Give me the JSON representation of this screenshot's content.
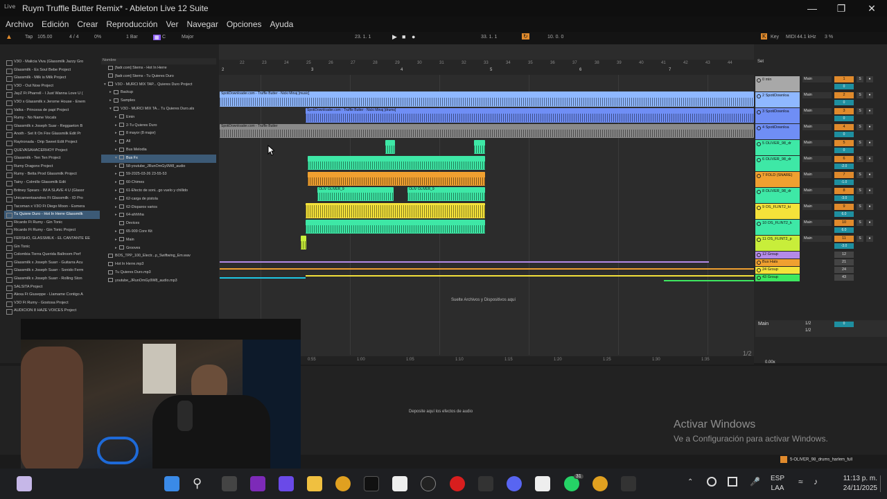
{
  "window": {
    "title": "Ruym Truffle Butter Remix* - Ableton Live 12 Suite",
    "logo": "Live"
  },
  "menu": [
    "Archivo",
    "Edición",
    "Crear",
    "Reproducción",
    "Ver",
    "Navegar",
    "Opciones",
    "Ayuda"
  ],
  "control_bar": {
    "tap": "Tap",
    "tempo": "105.00",
    "sig": "4 / 4",
    "pct": "0%",
    "bar": "1 Bar",
    "key": "C",
    "scale": "Major",
    "position": "23. 1. 1",
    "loop_start": "33. 1. 1",
    "loop_len": "10. 0. 0",
    "key_label": "Key",
    "midi": "MIDI",
    "sample_rate": "44.1 kHz",
    "cpu": "3 %"
  },
  "browser": {
    "column_header": "Nombre",
    "places": [
      "V3O - Malicia Viva (Glassmilk Jazzy Gro",
      "Glassmilk - Es Soul Bebe Project",
      "Glassmilk - Milk is Milk Project",
      "V3O - Out Now Project",
      "JayZ Ft Pharrell - I Just Wanna Love U (",
      "V3O x Glassmilk x Jerome House - Enem",
      "Valka - Princesa de papi Project",
      "Rumy - No Name Vocals",
      "Glassmilk x Joseph Suar - Reggaeton B",
      "Anoth - Set It On Fire Glassmilk Edit Pr",
      "Raytronada - Drip Sweet Edit Project",
      "QUEVASAHACERHOY Project",
      "Glassmilk - Ten Ten Project",
      "Rumy Dragonx Project",
      "Rumy - Betta Prod Glassmilk Project",
      "Tainy - Colmillo Glassmilk Edit",
      "Britney Spears - IM A SLAVE 4 U (Glassr",
      "Unicamentsandres Ft Glassmilk - ID Pro",
      "Tacoman x V3O Ft Diego Moon - Esmera",
      "Tu Quiere Duro - Hot In Herre Glassmilk",
      "Ricardo Ft Rumy - Gin Tonic",
      "Ricardo Ft Rumy - Gin Tonic Project",
      "FERSHO, GLASSMILK - EL CANTANTE EE",
      "Gin Tonic",
      "Colombia Tierra Querida Ballroom Perf",
      "Glassmilk x Joseph Suarr - Guitarra Acu",
      "Glassmilk x Joseph Suarr - Sonido Ferm",
      "Glassmilk x Joseph Suarr - Rolling Ston",
      "SALSITA Project",
      "Alexa Ft Giuseppe - Llamame Contigo A",
      "V3O Ft Rumy - Gostosa Project",
      "AUDICION 8 HAZE VOICES Project"
    ],
    "places_selected": 19,
    "files": [
      {
        "tw": "",
        "label": "[fadr.com] Stems - Hot In Herre"
      },
      {
        "tw": "",
        "label": "[fadr.com] Stems - Tu Quieres Duro"
      },
      {
        "tw": "▾",
        "label": "V3O - MURCI MIX TAP... Quieres Duro Project"
      },
      {
        "tw": "▸",
        "label": "Backup"
      },
      {
        "tw": "▸",
        "label": "Samples"
      },
      {
        "tw": "▾",
        "label": "V3O - MURCI MIX TA... Tu Quieres Duro.als"
      },
      {
        "tw": "▸",
        "label": "Emin"
      },
      {
        "tw": "▸",
        "label": "2-Tu Quieres Duro"
      },
      {
        "tw": "▸",
        "label": "8 mayor (8 major)"
      },
      {
        "tw": "▸",
        "label": "All"
      },
      {
        "tw": "▸",
        "label": "Bus Melodia"
      },
      {
        "tw": "▾",
        "label": "Bus Fx"
      },
      {
        "tw": "▸",
        "label": "58-youtube_JRunOmGy9W8_audio"
      },
      {
        "tw": "▸",
        "label": "59-2025-03-26 23-55-53"
      },
      {
        "tw": "▸",
        "label": "60-Chimes"
      },
      {
        "tw": "▸",
        "label": "61-Efecto de soni...go vuelo y chillido"
      },
      {
        "tw": "▸",
        "label": "62-carga de pistola"
      },
      {
        "tw": "▸",
        "label": "62-Disparos varios"
      },
      {
        "tw": "▸",
        "label": "64-ahhhha"
      },
      {
        "tw": "",
        "label": "Devices"
      },
      {
        "tw": "▸",
        "label": "65-909 Core Kit"
      },
      {
        "tw": "▸",
        "label": "Main"
      },
      {
        "tw": "▸",
        "label": "Grooves"
      },
      {
        "tw": "",
        "label": "BOS_TPP_100_Electr...p_Swiftwing_Em.wav"
      },
      {
        "tw": "",
        "label": "Hot In Herre.mp3"
      },
      {
        "tw": "",
        "label": "Tu Quieres Duro.mp3"
      },
      {
        "tw": "",
        "label": "youtube_JRunOmGy9W8_audio.mp3"
      }
    ],
    "files_selected": 11
  },
  "arrangement": {
    "ruler": [
      "22",
      "23",
      "24",
      "25",
      "26",
      "27",
      "28",
      "29",
      "30",
      "31",
      "32",
      "33",
      "34",
      "35",
      "36",
      "37",
      "38",
      "39",
      "40",
      "41",
      "42",
      "43",
      "44"
    ],
    "markers": [
      "2",
      "3",
      "4",
      "5",
      "6",
      "7"
    ],
    "clips": {
      "c1": "SpotiDownloader.com - Truffle Butter - Nicki Minaj [music]",
      "c2": "SpotiDownloader.com - Truffle Butter - Nicki Minaj [drums]",
      "c3": "SpotiDownloader.com - Truffle Butter",
      "c4": "OLIV OLIVER_9",
      "c5": "OLIV OLIVER_9"
    },
    "drop_hint": "Suelte Archivos y Dispositivos aquí",
    "time_axis": [
      "0:55",
      "1:00",
      "1:05",
      "1:10",
      "1:15",
      "1:20",
      "1:25",
      "1:30",
      "1:35"
    ],
    "page": "1/2"
  },
  "mixer": {
    "set_label": "Set",
    "tracks": [
      {
        "name": "0 min",
        "color": "#a8a8a8",
        "route": "Main",
        "num": "1",
        "vol": "0"
      },
      {
        "name": "2 SpotiDownloa",
        "color": "#8fb8ff",
        "route": "Main",
        "num": "2",
        "vol": "0"
      },
      {
        "name": "3 SpotiDownloa",
        "color": "#6f8ef5",
        "route": "Main",
        "num": "3",
        "vol": "0"
      },
      {
        "name": "4 SpotiDownloa",
        "color": "#6f8ef5",
        "route": "Main",
        "num": "4",
        "vol": "0"
      },
      {
        "name": "5 OLIVER_98_dr",
        "color": "#3ee8a6",
        "route": "Main",
        "num": "5",
        "vol": "0"
      },
      {
        "name": "6 OLIVER_98_dr",
        "color": "#3ee8a6",
        "route": "Main",
        "num": "6",
        "vol": "-2.0"
      },
      {
        "name": "7 FOLD (SNARE)",
        "color": "#f0a030",
        "route": "Main",
        "num": "7",
        "vol": "-1.0"
      },
      {
        "name": "8 OLIVER_98_dr",
        "color": "#3ee8a6",
        "route": "Main",
        "num": "8",
        "vol": "-3.0"
      },
      {
        "name": "9 OS_FLINT2_ki",
        "color": "#f4e23a",
        "route": "Main",
        "num": "9",
        "vol": "6.0"
      },
      {
        "name": "10 OS_FLINT2_k",
        "color": "#3ee8a6",
        "route": "Main",
        "num": "10",
        "vol": "6.0"
      },
      {
        "name": "11 OS_FLINT2_p",
        "color": "#c8ee3a",
        "route": "Main",
        "num": "11",
        "vol": "-3.0"
      }
    ],
    "groups": [
      {
        "name": "12 Group",
        "color": "#b48ae8",
        "num": "12"
      },
      {
        "name": "Bus Hats",
        "color": "#f0a030",
        "num": "21"
      },
      {
        "name": "24 Group",
        "color": "#f4e23a",
        "num": "24"
      },
      {
        "name": "43 Group",
        "color": "#3ee860",
        "num": "43"
      }
    ],
    "main": {
      "name": "Main",
      "route1": "1/2",
      "route2": "1/2",
      "vol": "0"
    },
    "zoom": "0.00x"
  },
  "device_panel": {
    "hint": "Deposite aquí los efectos de audio"
  },
  "status": {
    "clip": "5-OLIVER_98_drums_harlem_full"
  },
  "watermark": {
    "line1": "Activar Windows",
    "line2": "Ve a Configuración para activar Windows."
  },
  "taskbar": {
    "lang1": "ESP",
    "lang2": "LAA",
    "time": "11:13 p. m.",
    "date": "24/11/2025",
    "chrome_badge": "31"
  }
}
